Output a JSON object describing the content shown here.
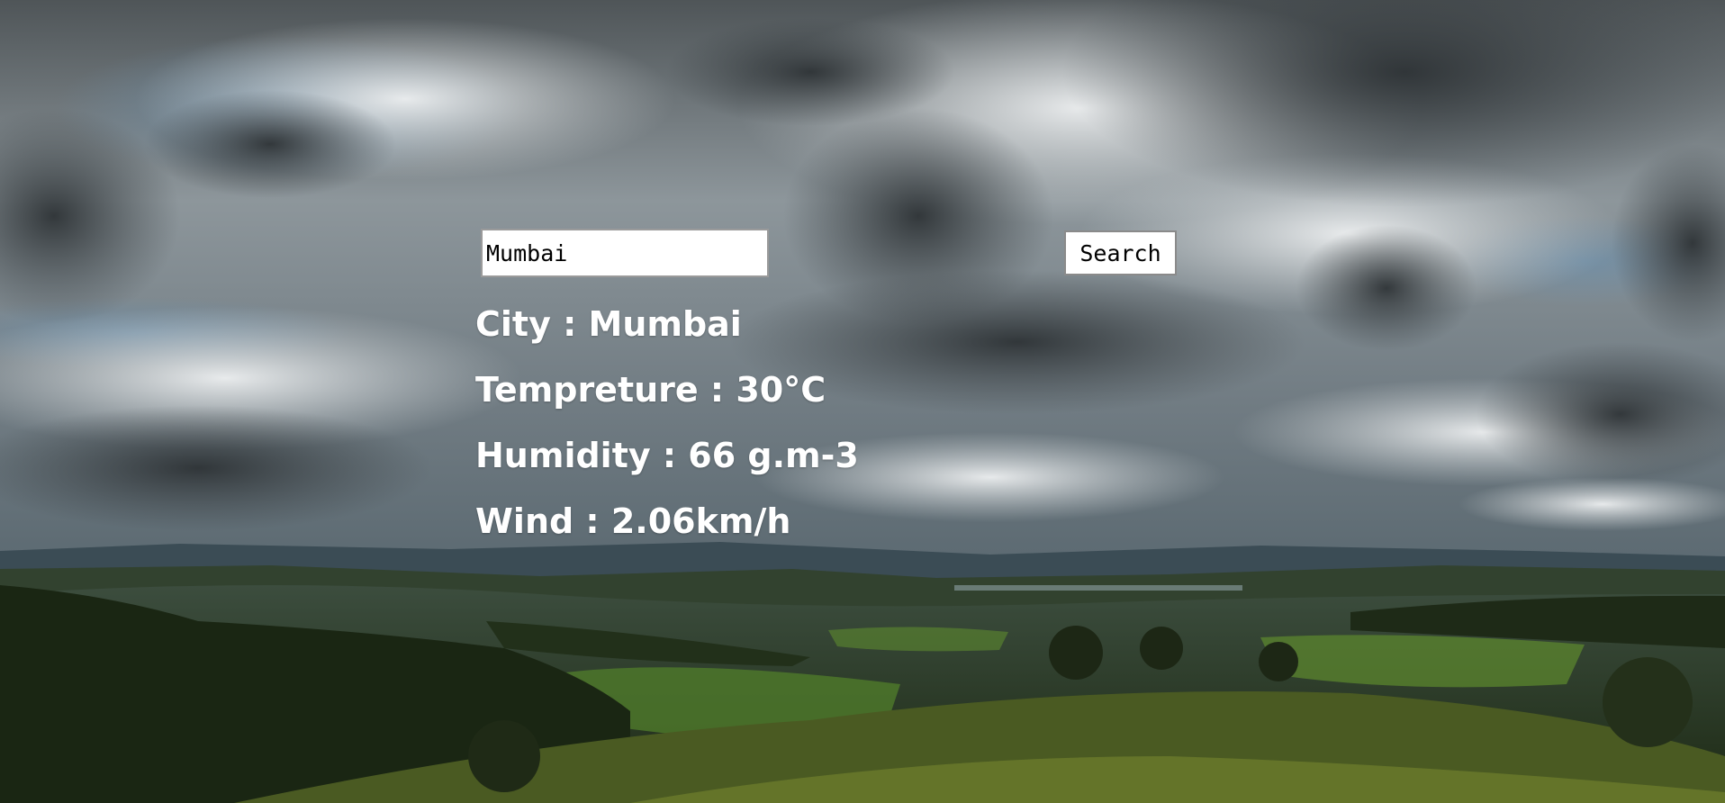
{
  "background": {
    "description_icon": "cloudy-landscape-photo",
    "sky_color": "#7f8a92",
    "cloud_dark": "#3f4548",
    "cloud_light": "#d4d7d8",
    "hills_color": "#2f3f25",
    "grass_color": "#5d7a2a"
  },
  "search": {
    "value": "Mumbai",
    "button_label": "Search"
  },
  "weather": {
    "city_line": "City : Mumbai",
    "temperature_line": "Tempreture : 30°C",
    "humidity_line": "Humidity : 66 g.m-3",
    "wind_line": "Wind : 2.06km/h"
  }
}
